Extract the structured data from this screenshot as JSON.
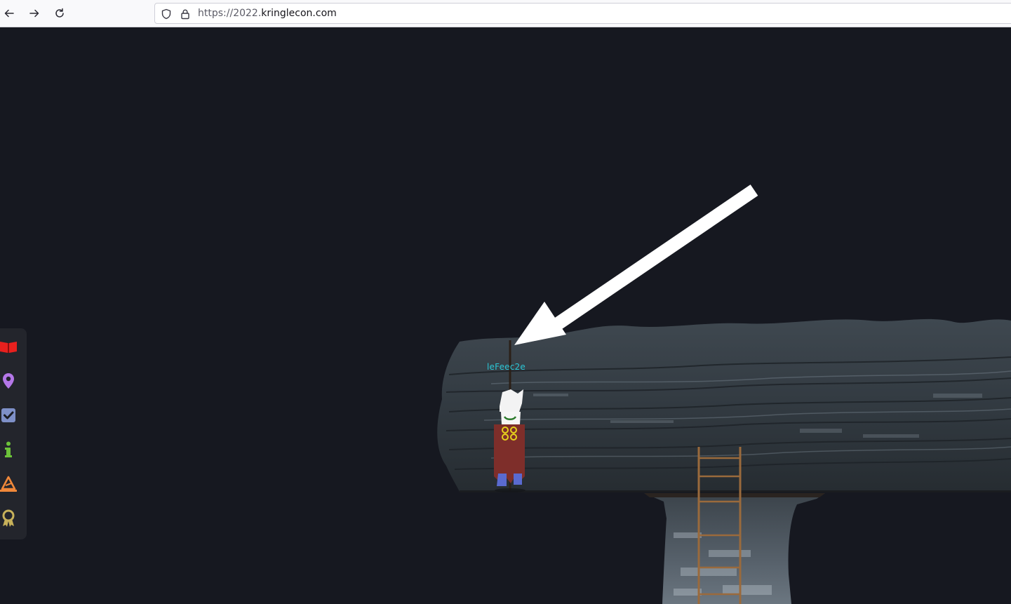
{
  "browser": {
    "back_icon": "arrow-left-icon",
    "forward_icon": "arrow-right-icon",
    "reload_icon": "reload-icon",
    "url_scheme": "https://",
    "url_subdomain": "2022.",
    "url_domain": "kringlecon.com"
  },
  "game": {
    "player_name": "leFeec2e",
    "side_menu": [
      {
        "name": "badge-book-icon",
        "color": "#e8201e"
      },
      {
        "name": "location-pin-icon",
        "color": "#b477e8"
      },
      {
        "name": "objectives-check-icon",
        "color": "#7e90c8"
      },
      {
        "name": "info-icon",
        "color": "#6cc23a"
      },
      {
        "name": "hat-icon",
        "color": "#f0883a"
      },
      {
        "name": "achievement-ribbon-icon",
        "color": "#c7b15a"
      }
    ]
  }
}
